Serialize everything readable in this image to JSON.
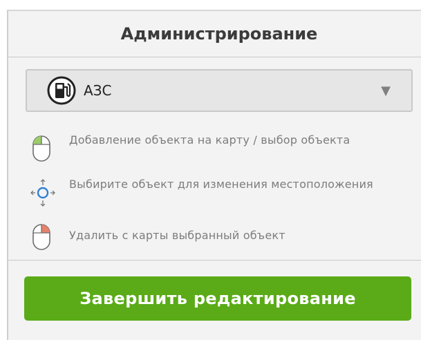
{
  "panel": {
    "title": "Администрирование",
    "object_select": {
      "value": "АЗС",
      "icon": "fuel-pump-icon"
    },
    "hints": [
      {
        "icon": "mouse-left-click-icon",
        "text": "Добавление объекта на карту / выбор объекта",
        "accent": "#9ccc6a"
      },
      {
        "icon": "move-arrows-icon",
        "text": "Выбирите объект для изменения местоположения",
        "accent": "#2f7fd4"
      },
      {
        "icon": "mouse-right-click-icon",
        "text": "Удалить с карты выбранный объект",
        "accent": "#e4826c"
      }
    ],
    "finish_label": "Завершить редактирование",
    "colors": {
      "finish": "#5aab17",
      "background": "#f3f3f3"
    }
  }
}
